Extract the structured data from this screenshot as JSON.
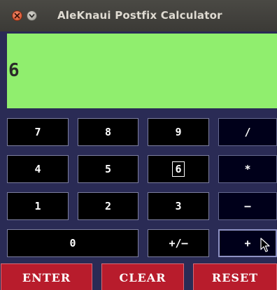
{
  "window": {
    "title": "AleKnaui Postfix Calculator"
  },
  "display": {
    "value": "6",
    "background": "#90ee6e"
  },
  "keypad": {
    "row1": [
      "7",
      "8",
      "9",
      "/"
    ],
    "row2": [
      "4",
      "5",
      "6",
      "*"
    ],
    "row3": [
      "1",
      "2",
      "3",
      "–"
    ],
    "row4": [
      "0",
      "+/–",
      "+"
    ]
  },
  "controls": {
    "enter_label": "ENTER",
    "clear_label": "CLEAR",
    "reset_label": "RESET",
    "color": "#b81c2c"
  },
  "icons": {
    "close": "close-icon",
    "minimize": "minimize-icon",
    "cursor": "mouse-pointer-icon"
  }
}
